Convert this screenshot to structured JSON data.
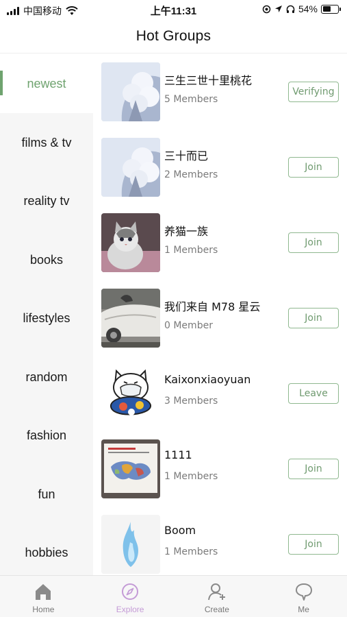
{
  "status_bar": {
    "carrier": "中国移动",
    "time": "上午11:31",
    "battery": "54%",
    "battery_level": 0.54
  },
  "header": {
    "title": "Hot Groups"
  },
  "sidebar": {
    "items": [
      {
        "label": "newest",
        "active": true
      },
      {
        "label": "films & tv",
        "active": false
      },
      {
        "label": "reality tv",
        "active": false
      },
      {
        "label": "books",
        "active": false
      },
      {
        "label": "lifestyles",
        "active": false
      },
      {
        "label": "random",
        "active": false
      },
      {
        "label": "fashion",
        "active": false
      },
      {
        "label": "fun",
        "active": false
      },
      {
        "label": "hobbies",
        "active": false
      }
    ]
  },
  "groups": [
    {
      "name": "三生三世十里桃花",
      "members": "5 Members",
      "action": "Verifying",
      "thumb": "snow-tree"
    },
    {
      "name": "三十而已",
      "members": "2 Members",
      "action": "Join",
      "thumb": "snow-tree"
    },
    {
      "name": "养猫一族",
      "members": "1 Members",
      "action": "Join",
      "thumb": "kitten"
    },
    {
      "name": "我们来自 M78 星云",
      "members": "0 Member",
      "action": "Join",
      "thumb": "car"
    },
    {
      "name": "Kaixonxiaoyuan",
      "members": "3 Members",
      "action": "Leave",
      "thumb": "cartoon-cat"
    },
    {
      "name": "1111",
      "members": "1 Members",
      "action": "Join",
      "thumb": "map-poster"
    },
    {
      "name": "Boom",
      "members": "1 Members",
      "action": "Join",
      "thumb": "blue-flame"
    }
  ],
  "tabbar": {
    "items": [
      {
        "label": "Home",
        "icon": "home-icon",
        "active": false
      },
      {
        "label": "Explore",
        "icon": "compass-icon",
        "active": true
      },
      {
        "label": "Create",
        "icon": "add-user-icon",
        "active": false
      },
      {
        "label": "Me",
        "icon": "chat-bubble-icon",
        "active": false
      }
    ]
  },
  "colors": {
    "accent": "#6fa36f",
    "explore_active": "#c49bd6",
    "sidebar_bg": "#f6f6f6"
  }
}
